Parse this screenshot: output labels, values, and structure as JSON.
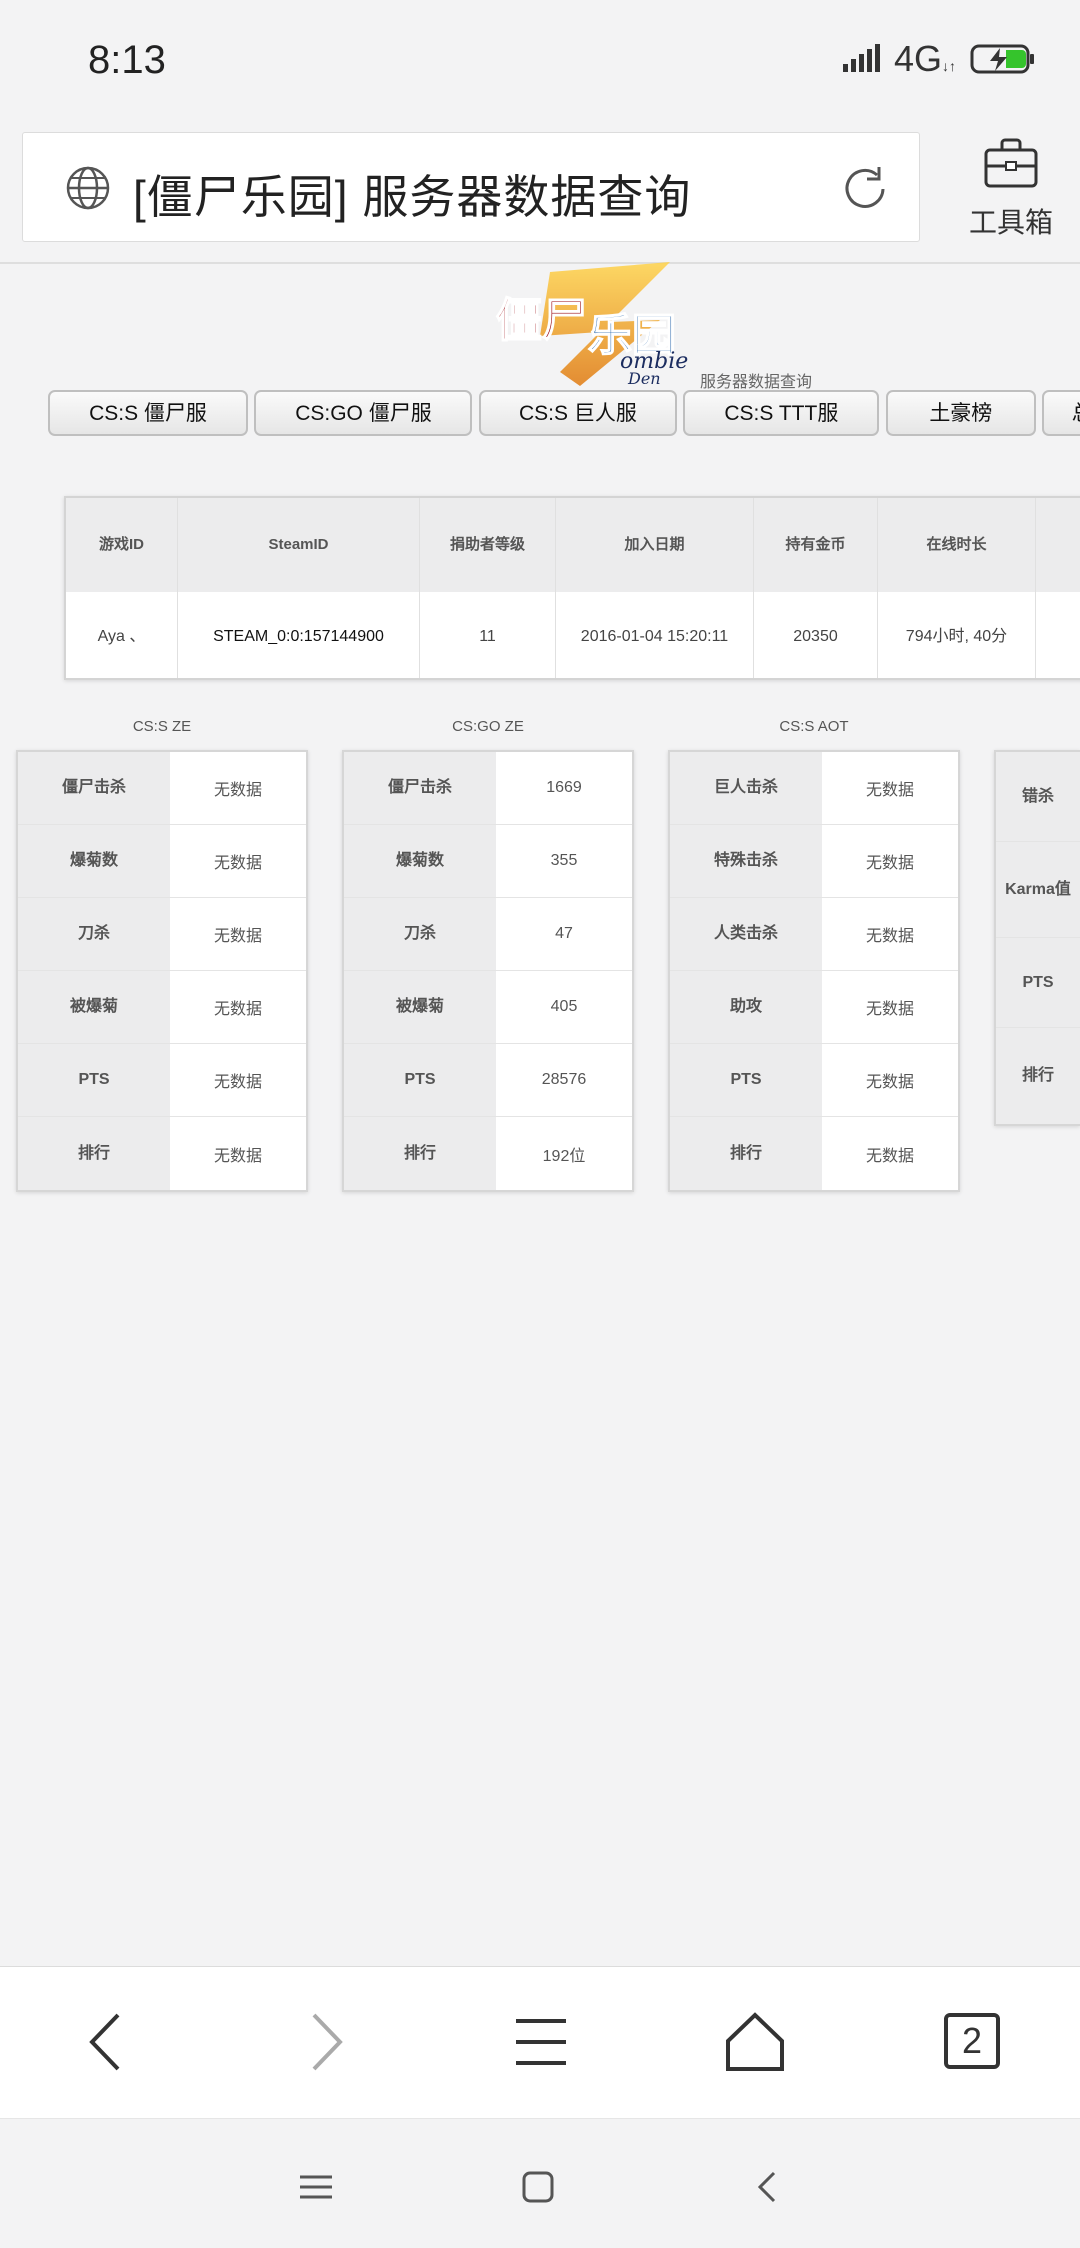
{
  "status": {
    "time": "8:13",
    "network": "4G"
  },
  "browser": {
    "url_title": "[僵尸乐园] 服务器数据查询",
    "toolbox_label": "工具箱",
    "tab_count": "2"
  },
  "site": {
    "logo_subtitle": "服务器数据查询"
  },
  "nav_tabs": [
    "CS:S 僵尸服",
    "CS:GO 僵尸服",
    "CS:S 巨人服",
    "CS:S TTT服",
    "土豪榜",
    "总"
  ],
  "profile": {
    "headers": [
      "游戏ID",
      "SteamID",
      "捐助者等级",
      "加入日期",
      "持有金币",
      "在线时长",
      ""
    ],
    "values": [
      "Aya 、",
      "STEAM_0:0:157144900",
      "11",
      "2016-01-04 15:20:11",
      "20350",
      "794小时, 40分",
      ""
    ]
  },
  "stats": [
    {
      "title": "CS:S ZE",
      "rows": [
        {
          "k": "僵尸击杀",
          "v": "无数据"
        },
        {
          "k": "爆菊数",
          "v": "无数据"
        },
        {
          "k": "刀杀",
          "v": "无数据"
        },
        {
          "k": "被爆菊",
          "v": "无数据"
        },
        {
          "k": "PTS",
          "v": "无数据"
        },
        {
          "k": "排行",
          "v": "无数据"
        }
      ]
    },
    {
      "title": "CS:GO ZE",
      "rows": [
        {
          "k": "僵尸击杀",
          "v": "1669"
        },
        {
          "k": "爆菊数",
          "v": "355"
        },
        {
          "k": "刀杀",
          "v": "47"
        },
        {
          "k": "被爆菊",
          "v": "405"
        },
        {
          "k": "PTS",
          "v": "28576"
        },
        {
          "k": "排行",
          "v": "192位"
        }
      ]
    },
    {
      "title": "CS:S AOT",
      "rows": [
        {
          "k": "巨人击杀",
          "v": "无数据"
        },
        {
          "k": "特殊击杀",
          "v": "无数据"
        },
        {
          "k": "人类击杀",
          "v": "无数据"
        },
        {
          "k": "助攻",
          "v": "无数据"
        },
        {
          "k": "PTS",
          "v": "无数据"
        },
        {
          "k": "排行",
          "v": "无数据"
        }
      ]
    },
    {
      "title": "",
      "rows": [
        {
          "k": "错杀",
          "v": ""
        },
        {
          "k": "Karma值",
          "v": ""
        },
        {
          "k": "PTS",
          "v": ""
        },
        {
          "k": "排行",
          "v": ""
        }
      ]
    }
  ]
}
